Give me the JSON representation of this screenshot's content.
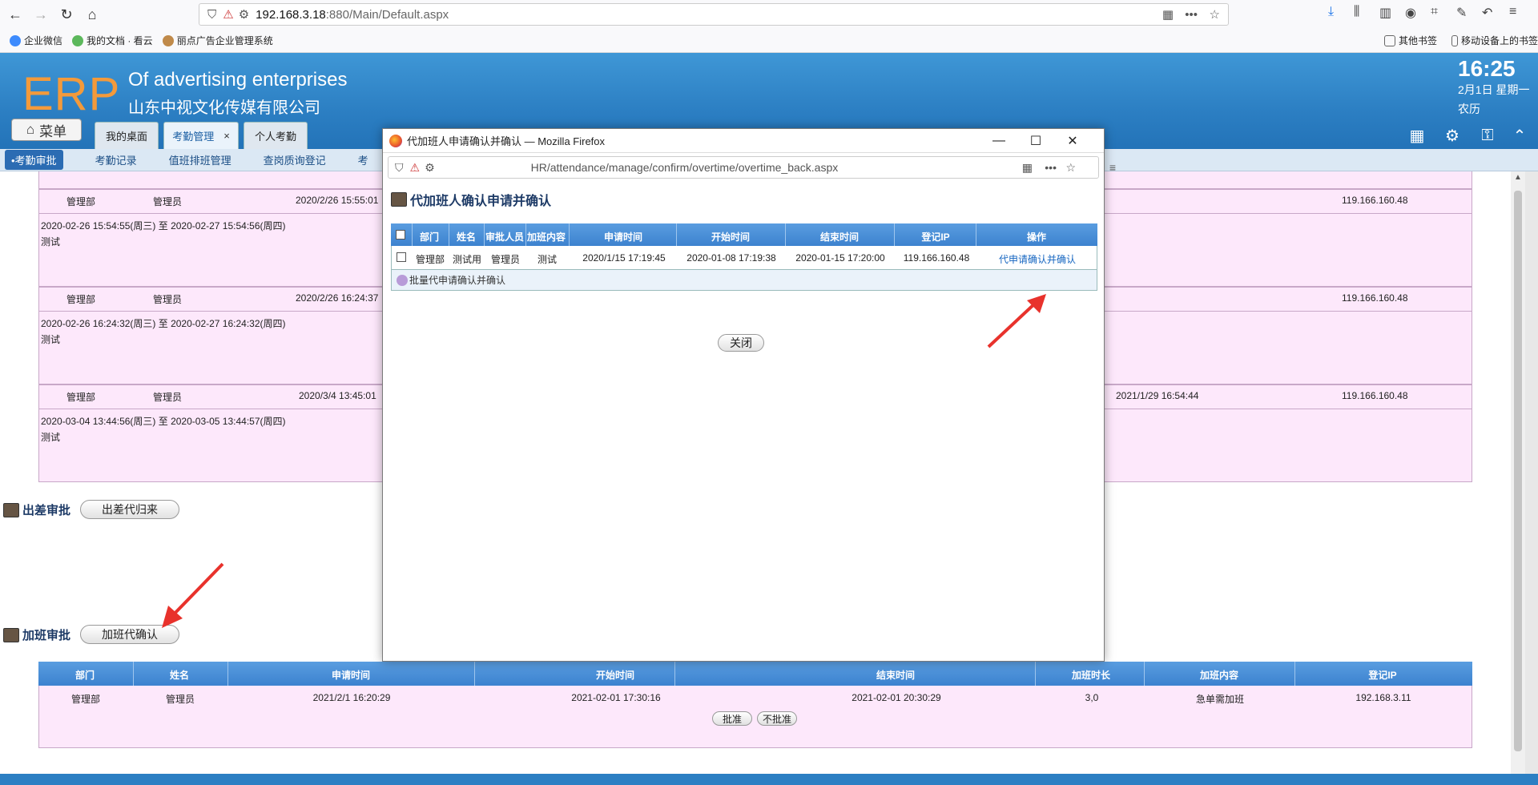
{
  "browser": {
    "url_host": "192.168.3.18",
    "url_rest": ":880/Main/Default.aspx",
    "bookmarks": [
      "企业微信",
      "我的文档 · 看云",
      "丽点广告企业管理系统"
    ],
    "bookmarks_right": [
      "其他书签",
      "移动设备上的书签"
    ]
  },
  "header": {
    "logo": "ERP",
    "title_en": "Of advertising enterprises",
    "title_cn": "山东中视文化传媒有限公司",
    "time": "16:25",
    "date": "2月1日 星期一",
    "lunar": "农历",
    "menu_label": "菜单",
    "tabs": [
      {
        "label": "我的桌面"
      },
      {
        "label": "考勤管理",
        "close": "×"
      },
      {
        "label": "个人考勤"
      }
    ]
  },
  "subnav": [
    "•考勤审批",
    "考勤记录",
    "值班排班管理",
    "查岗质询登记",
    "考"
  ],
  "records": [
    {
      "dept": "管理部",
      "name": "管理员",
      "time": "2020/2/26 15:55:01",
      "ip": "119.166.160.48",
      "range": "2020-02-26 15:54:55(周三) 至 2020-02-27 15:54:56(周四)",
      "note": "测试"
    },
    {
      "dept": "管理部",
      "name": "管理员",
      "time": "2020/2/26 16:24:37",
      "ip": "119.166.160.48",
      "range": "2020-02-26 16:24:32(周三) 至 2020-02-27 16:24:32(周四)",
      "note": "测试"
    },
    {
      "dept": "管理部",
      "name": "管理员",
      "time": "2020/3/4 13:45:01",
      "time2": "2021/1/29 16:54:44",
      "ip": "119.166.160.48",
      "range": "2020-03-04 13:44:56(周三) 至 2020-03-05 13:44:57(周四)",
      "note": "测试"
    }
  ],
  "sections": {
    "trip": {
      "title": "出差审批",
      "button": "出差代归来"
    },
    "overtime": {
      "title": "加班审批",
      "button": "加班代确认"
    }
  },
  "overtime_table": {
    "headers": [
      "部门",
      "姓名",
      "申请时间",
      "开始时间",
      "结束时间",
      "加班时长",
      "加班内容",
      "登记IP"
    ],
    "row": [
      "管理部",
      "管理员",
      "2021/2/1 16:20:29",
      "2021-02-01 17:30:16",
      "2021-02-01 20:30:29",
      "3,0",
      "急单需加班",
      "192.168.3.11"
    ],
    "approve": "批准",
    "reject": "不批准"
  },
  "popup": {
    "window_title": "代加班人申请确认并确认 — Mozilla Firefox",
    "url": "HR/attendance/manage/confirm/overtime/overtime_back.aspx",
    "heading": "代加班人确认申请并确认",
    "headers": [
      "部门",
      "姓名",
      "审批人员",
      "加班内容",
      "申请时间",
      "开始时间",
      "结束时间",
      "登记IP",
      "操作"
    ],
    "row": [
      "管理部",
      "测试用",
      "管理员",
      "测试",
      "2020/1/15 17:19:45",
      "2020-01-08 17:19:38",
      "2020-01-15 17:20:00",
      "119.166.160.48"
    ],
    "action": "代申请确认并确认",
    "batch": "批量代申请确认并确认",
    "close": "关闭"
  },
  "colors": {
    "accent": "#2c7fc3",
    "logo": "#f39a3b",
    "row_pink": "#fde8fb",
    "arrow": "#e8322c"
  }
}
